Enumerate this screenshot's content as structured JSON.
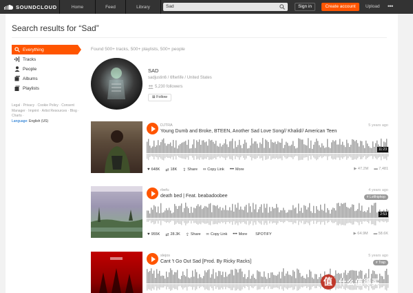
{
  "header": {
    "logo_text": "SOUNDCLOUD",
    "nav": {
      "home": "Home",
      "feed": "Feed",
      "library": "Library"
    },
    "search_value": "Sad",
    "sign_in": "Sign in",
    "create_account": "Create account",
    "upload": "Upload",
    "more": "•••"
  },
  "page_title": "Search results for “Sad”",
  "sidebar": {
    "items": [
      {
        "label": "Everything",
        "icon": "search-icon",
        "active": true
      },
      {
        "label": "Tracks",
        "icon": "waveform-icon"
      },
      {
        "label": "People",
        "icon": "person-icon"
      },
      {
        "label": "Albums",
        "icon": "album-icon"
      },
      {
        "label": "Playlists",
        "icon": "playlist-icon"
      }
    ],
    "footer_links": "Legal · Privacy · Cookie Policy · Consent Manager · Imprint · Artist Resources · Blog · Charts ·",
    "language_label": "Language:",
    "language_value": "English (US)"
  },
  "results": {
    "found": "Found 500+ tracks, 500+ playlists, 500+ people",
    "user": {
      "name": "SAD",
      "subtitle": "sadjustin6 / 6fterlife / United States",
      "followers": "5,230 followers",
      "follow_label": "Follow"
    },
    "tracks": [
      {
        "uploader": "DJTRA",
        "title": "Young Dumb and Broke, BTEEN, Another Sad Love Song// Khalid// American Teen",
        "age": "5 years ago",
        "tag": "",
        "duration": "11:23",
        "likes": "648K",
        "reposts": "18K",
        "share": "Share",
        "copy_link": "Copy Link",
        "more": "More",
        "extra": "",
        "plays": "47.2M",
        "comments": "7,481"
      },
      {
        "uploader": "rbefu",
        "title": "death bed | Feat. beabadoobee",
        "age": "4 years ago",
        "tag": "# Lofihiphop",
        "duration": "2:53",
        "likes": "955K",
        "reposts": "28.3K",
        "share": "Share",
        "copy_link": "Copy Link",
        "more": "More",
        "extra": "SPOTIFY",
        "plays": "64.9M",
        "comments": "58.6K"
      },
      {
        "uploader": "slejos",
        "title": "Cant 't Go Out Sad [Prod. By Ricky Racks]",
        "age": "5 years ago",
        "tag": "# Trap",
        "duration": "",
        "likes": "",
        "reposts": "",
        "share": "",
        "copy_link": "",
        "more": "",
        "extra": "",
        "plays": "",
        "comments": ""
      }
    ]
  },
  "watermark": "值 什么值得买",
  "colors": {
    "accent": "#ff5500",
    "header": "#333333",
    "waveform": "#999999"
  }
}
